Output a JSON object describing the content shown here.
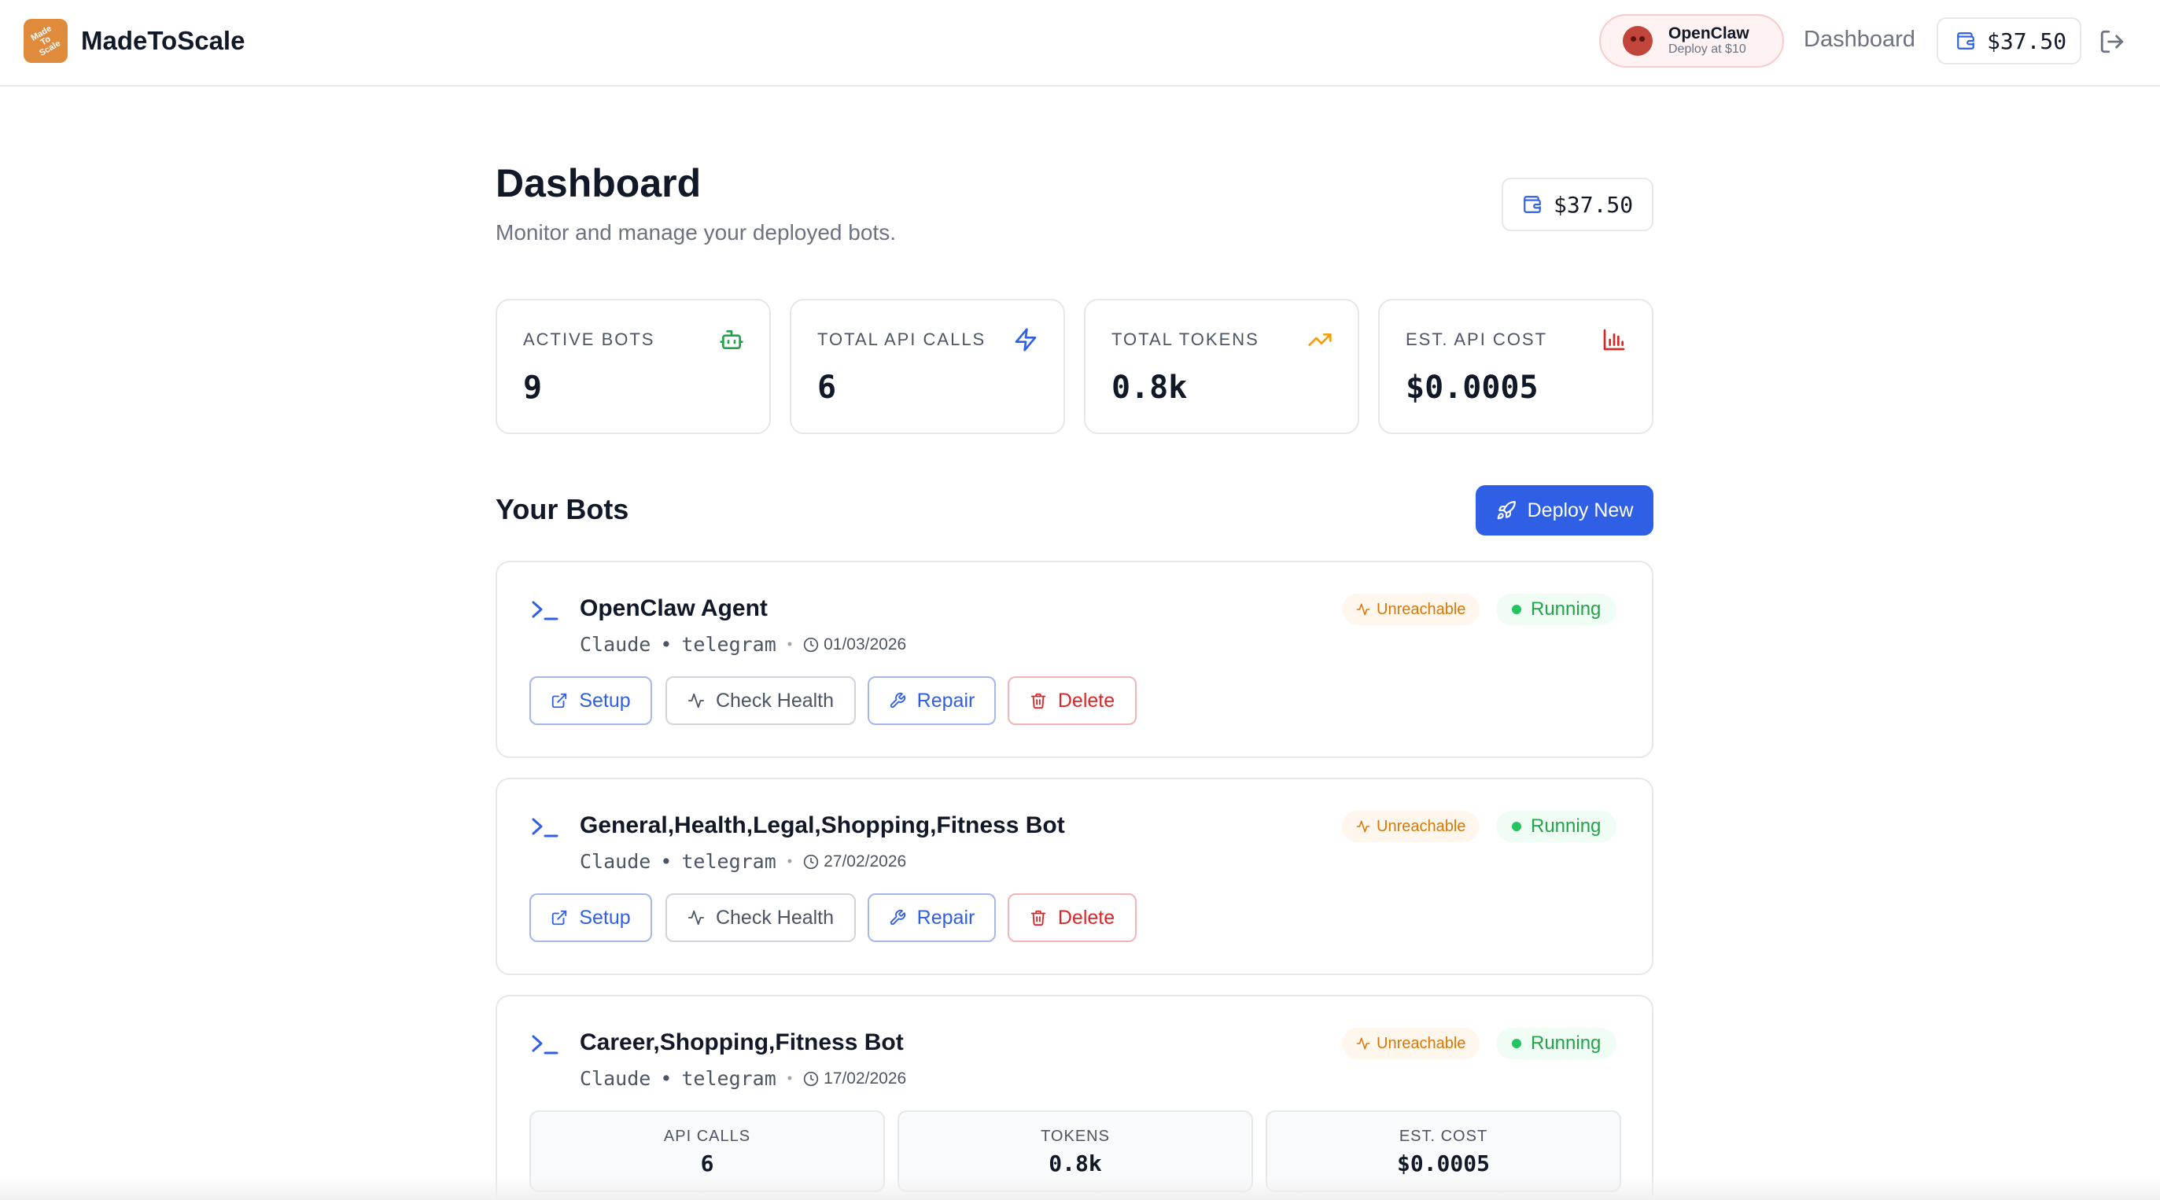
{
  "header": {
    "logo_text": "Made\nTo\nScale",
    "brand": "MadeToScale",
    "promo": {
      "name": "OpenClaw",
      "sub": "Deploy at $10"
    },
    "nav_dashboard": "Dashboard",
    "wallet_balance": "$37.50"
  },
  "page": {
    "title": "Dashboard",
    "subtitle": "Monitor and manage your deployed bots.",
    "wallet_balance": "$37.50"
  },
  "stats": [
    {
      "label": "ACTIVE BOTS",
      "value": "9",
      "icon": "bot-icon",
      "color": "#22a34a"
    },
    {
      "label": "TOTAL API CALLS",
      "value": "6",
      "icon": "lightning-icon",
      "color": "#2f5fe4"
    },
    {
      "label": "TOTAL TOKENS",
      "value": "0.8k",
      "icon": "trending-up-icon",
      "color": "#f59e0b"
    },
    {
      "label": "EST. API COST",
      "value": "$0.0005",
      "icon": "bar-chart-icon",
      "color": "#dc2626"
    }
  ],
  "bots_section": {
    "title": "Your Bots",
    "deploy_label": "Deploy New"
  },
  "bots": [
    {
      "name": "OpenClaw Agent",
      "model": "Claude",
      "channel": "telegram",
      "sep": "•",
      "date": "01/03/2026",
      "health": "Unreachable",
      "status": "Running"
    },
    {
      "name": "General,Health,Legal,Shopping,Fitness Bot",
      "model": "Claude",
      "channel": "telegram",
      "sep": "•",
      "date": "27/02/2026",
      "health": "Unreachable",
      "status": "Running"
    },
    {
      "name": "Career,Shopping,Fitness Bot",
      "model": "Claude",
      "channel": "telegram",
      "sep": "•",
      "date": "17/02/2026",
      "health": "Unreachable",
      "status": "Running"
    }
  ],
  "actions": {
    "setup": "Setup",
    "check_health": "Check Health",
    "repair": "Repair",
    "delete": "Delete"
  },
  "bot_usage": {
    "api_calls_label": "API CALLS",
    "api_calls": "6",
    "tokens_label": "TOKENS",
    "tokens": "0.8k",
    "cost_label": "EST. COST",
    "cost": "$0.0005"
  },
  "colors": {
    "primary": "#2f5fe4",
    "warning": "#d97706",
    "success": "#22a34a",
    "danger": "#dc2626"
  }
}
